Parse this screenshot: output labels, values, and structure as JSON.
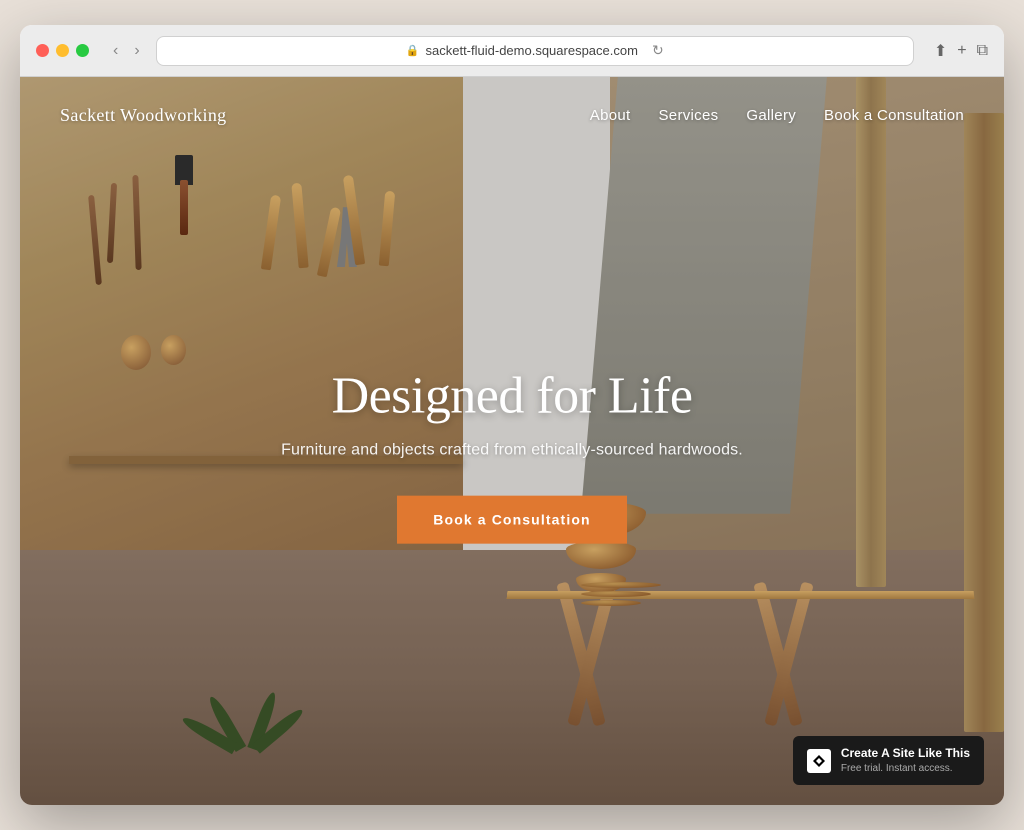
{
  "browser": {
    "url": "sackett-fluid-demo.squarespace.com",
    "back_btn": "‹",
    "forward_btn": "›"
  },
  "nav": {
    "logo": "Sackett Woodworking",
    "links": [
      {
        "id": "about",
        "label": "About"
      },
      {
        "id": "services",
        "label": "Services"
      },
      {
        "id": "gallery",
        "label": "Gallery"
      },
      {
        "id": "book",
        "label": "Book a Consultation"
      }
    ]
  },
  "hero": {
    "title": "Designed for Life",
    "subtitle": "Furniture and objects crafted from ethically-sourced hardwoods.",
    "cta_label": "Book a Consultation"
  },
  "badge": {
    "title": "Create A Site Like This",
    "subtitle": "Free trial. Instant access."
  },
  "colors": {
    "cta_bg": "#e07830",
    "badge_bg": "#1a1a1a",
    "nav_text": "#ffffff"
  }
}
